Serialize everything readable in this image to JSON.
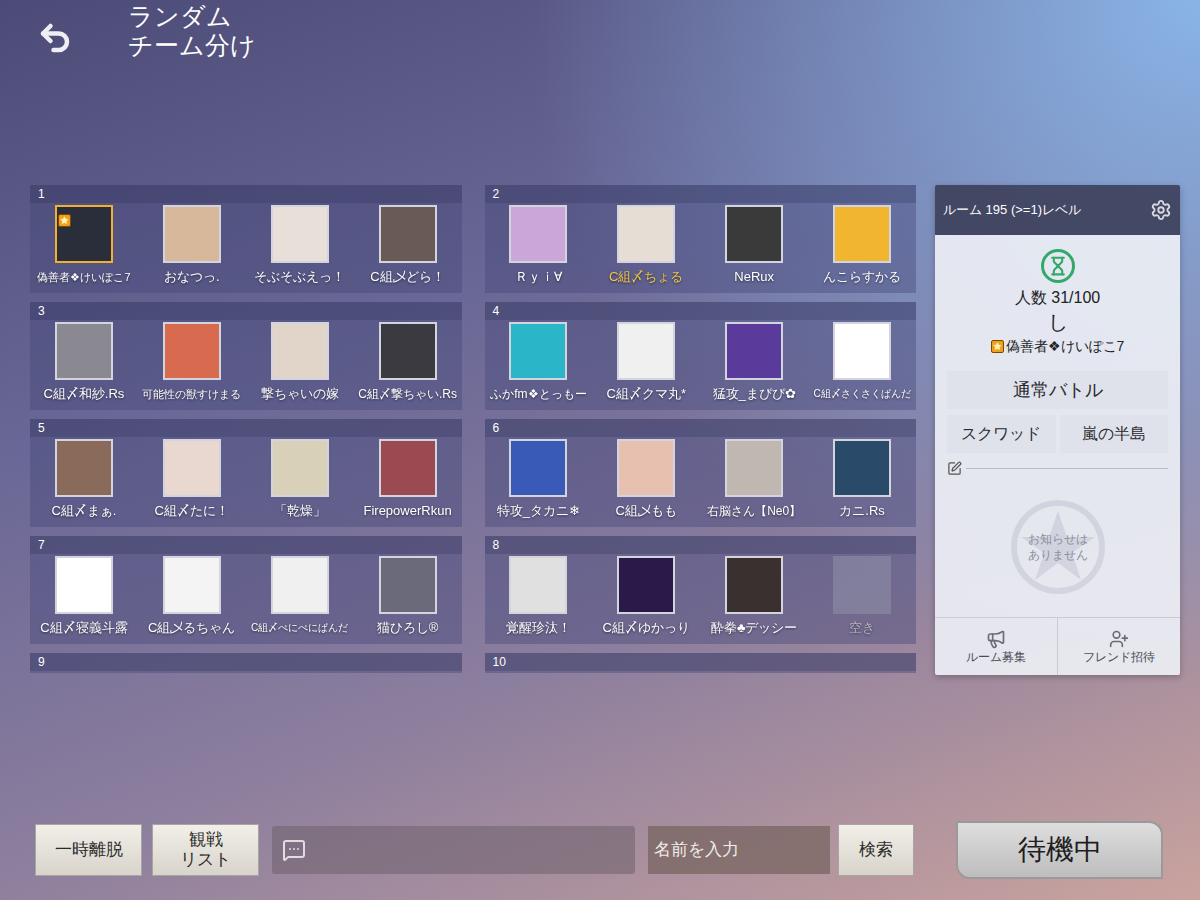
{
  "header": {
    "title": "ランダム\nチーム分け"
  },
  "teams": [
    {
      "number": "1",
      "players": [
        {
          "name": "偽善者❖けいぽこ7",
          "host": true,
          "self": false,
          "empty": false,
          "color": "#2a2d3a"
        },
        {
          "name": "おなつっ.",
          "host": false,
          "self": false,
          "empty": false,
          "color": "#d8b89a"
        },
        {
          "name": "そぶそぶえっ！",
          "host": false,
          "self": false,
          "empty": false,
          "color": "#e8e0d8"
        },
        {
          "name": "C組乄どら！",
          "host": false,
          "self": false,
          "empty": false,
          "color": "#6a5a55"
        }
      ]
    },
    {
      "number": "2",
      "players": [
        {
          "name": "Ｒｙｉ∀",
          "host": false,
          "self": false,
          "empty": false,
          "color": "#c9a7d8"
        },
        {
          "name": "C組〆ちょる",
          "host": false,
          "self": true,
          "empty": false,
          "color": "#e6ddd5"
        },
        {
          "name": "NeRux",
          "host": false,
          "self": false,
          "empty": false,
          "color": "#3a3a3a"
        },
        {
          "name": "んこらすかる",
          "host": false,
          "self": false,
          "empty": false,
          "color": "#f2b530"
        }
      ]
    },
    {
      "number": "3",
      "players": [
        {
          "name": "C組〆和紗.Rs",
          "host": false,
          "self": false,
          "empty": false,
          "color": "#8a8890"
        },
        {
          "name": "可能性の獣すけまる",
          "host": false,
          "self": false,
          "empty": false,
          "color": "#d86a50"
        },
        {
          "name": "撃ちゃいの嫁",
          "host": false,
          "self": false,
          "empty": false,
          "color": "#e0d5c8"
        },
        {
          "name": "C組〆撃ちゃい.Rs",
          "host": false,
          "self": false,
          "empty": false,
          "color": "#3a3a40"
        }
      ]
    },
    {
      "number": "4",
      "players": [
        {
          "name": "ふかfm❖とっもー",
          "host": false,
          "self": false,
          "empty": false,
          "color": "#2ab5c8"
        },
        {
          "name": "C組〆クマ丸*",
          "host": false,
          "self": false,
          "empty": false,
          "color": "#f0f0f0"
        },
        {
          "name": "猛攻_まぴぴ✿",
          "host": false,
          "self": false,
          "empty": false,
          "color": "#5a3a9a"
        },
        {
          "name": "C組〆さくさくぱんだ",
          "host": false,
          "self": false,
          "empty": false,
          "color": "#ffffff"
        }
      ]
    },
    {
      "number": "5",
      "players": [
        {
          "name": "C組〆まぁ.",
          "host": false,
          "self": false,
          "empty": false,
          "color": "#8a6a5a"
        },
        {
          "name": "C組〆たに！",
          "host": false,
          "self": false,
          "empty": false,
          "color": "#e8d8d0"
        },
        {
          "name": "「乾燥」",
          "host": false,
          "self": false,
          "empty": false,
          "color": "#d8d0b8"
        },
        {
          "name": "FirepowerRkun",
          "host": false,
          "self": false,
          "empty": false,
          "color": "#9a4a50"
        }
      ]
    },
    {
      "number": "6",
      "players": [
        {
          "name": "特攻_タカニ❄",
          "host": false,
          "self": false,
          "empty": false,
          "color": "#3a5ab8"
        },
        {
          "name": "C組乄もも",
          "host": false,
          "self": false,
          "empty": false,
          "color": "#e8c0b0"
        },
        {
          "name": "右脳さん【Ne0】",
          "host": false,
          "self": false,
          "empty": false,
          "color": "#c0b8b0"
        },
        {
          "name": "カニ.Rs",
          "host": false,
          "self": false,
          "empty": false,
          "color": "#2a4a6a"
        }
      ]
    },
    {
      "number": "7",
      "players": [
        {
          "name": "C組〆寝義斗露",
          "host": false,
          "self": false,
          "empty": false,
          "color": "#ffffff"
        },
        {
          "name": "C組乄るちゃん",
          "host": false,
          "self": false,
          "empty": false,
          "color": "#f4f4f4"
        },
        {
          "name": "C組〆ぺにぺにぱんだ",
          "host": false,
          "self": false,
          "empty": false,
          "color": "#f0f0f0"
        },
        {
          "name": "猫ひろし®",
          "host": false,
          "self": false,
          "empty": false,
          "color": "#6a6a7a"
        }
      ]
    },
    {
      "number": "8",
      "players": [
        {
          "name": "覚醒珍汰！",
          "host": false,
          "self": false,
          "empty": false,
          "color": "#e0e0e0"
        },
        {
          "name": "C組〆ゆかっり",
          "host": false,
          "self": false,
          "empty": false,
          "color": "#2a1a4a"
        },
        {
          "name": "酔拳♣デッシー",
          "host": false,
          "self": false,
          "empty": false,
          "color": "#3a3030"
        },
        {
          "name": "空き",
          "host": false,
          "self": false,
          "empty": true,
          "color": "#8e8ea6"
        }
      ]
    },
    {
      "number": "9",
      "players": []
    },
    {
      "number": "10",
      "players": []
    }
  ],
  "room": {
    "title": "ルーム 195 (>=1)レベル",
    "count": "人数 31/100",
    "name": "し",
    "host": "偽善者❖けいぽこ7",
    "mode": "通常バトル",
    "format": "スクワッド",
    "map": "嵐の半島",
    "notice": "お知らせは\nありません",
    "actions": [
      "ルーム募集",
      "フレンド招待"
    ]
  },
  "bottom_bar": {
    "buttons": [
      "一時離脱",
      "観戦\nリスト"
    ],
    "chat": {
      "placeholder": ""
    },
    "search": {
      "placeholder": "名前を入力",
      "button": "検索"
    },
    "ready_button": "待機中"
  }
}
